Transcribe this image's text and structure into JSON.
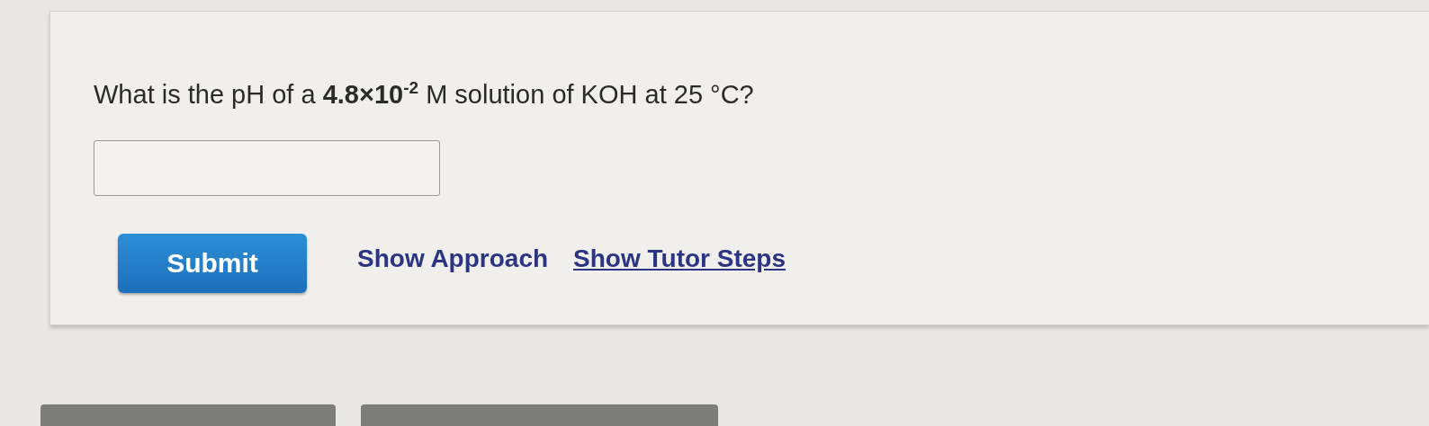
{
  "question": {
    "text": "What is the pH of a **4.8×10**$^{-2}$ M solution of KOH at 25 °C?"
  },
  "submit": {
    "label": "Submit"
  },
  "links": [
    {
      "label": "Show Approach",
      "underlined": false
    },
    {
      "label": "Show Tutor Steps",
      "underlined": true
    }
  ],
  "bottom_buttons": [
    {
      "kind": "button"
    },
    {
      "kind": "button"
    }
  ]
}
